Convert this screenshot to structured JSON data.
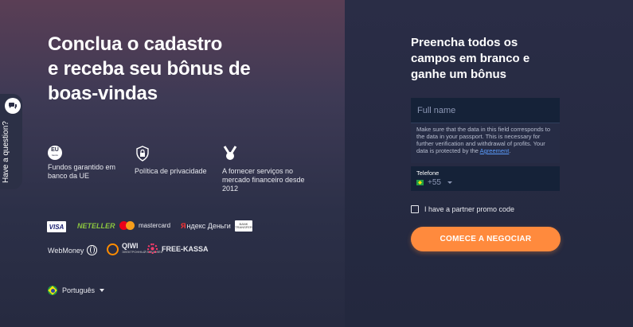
{
  "headline": [
    "Conclua o cadastro",
    "e receba seu bônus de",
    "boas-vindas"
  ],
  "question_tab": {
    "label": "Have a question?"
  },
  "features": [
    {
      "badge_top": "EU",
      "badge_bottom": "banks",
      "text": "Fundos garantido em banco da UE",
      "icon": "eu-bank-icon"
    },
    {
      "text": "Política de privacidade",
      "icon": "shield-lock-icon"
    },
    {
      "text": "A fornecer serviços no mercado financeiro desde 2012",
      "icon": "medal-icon"
    }
  ],
  "payments": {
    "visa": "VISA",
    "neteller": "NETELLER",
    "mastercard": "mastercard",
    "yandex_mark": "Я",
    "yandex": "ндекс Деньги",
    "bank_line1": "BANK",
    "bank_line2": "TRANSFER",
    "webmoney": "WebMoney",
    "qiwi": "QIWI",
    "qiwi_sub": "ЭЛЕКТРОННЫЙ КОШЕЛЁК",
    "freekassa": "FREE-KASSA"
  },
  "language": {
    "label": "Português"
  },
  "form": {
    "title": [
      "Preencha todos os",
      "campos em branco e",
      "ganhe um bônus"
    ],
    "name_placeholder": "Full name",
    "hint": "Make sure that the data in this field corresponds to the data in your passport. This is necessary for further verification and withdrawal of profits. Your data is protected by the ",
    "hint_link": "Agreement",
    "hint_end": ".",
    "phone_label": "Telefone",
    "phone_code": "+55",
    "promo_label": "I have a partner promo code",
    "cta": "COMECE A NEGOCIAR"
  },
  "colors": {
    "accent": "#ff8a3d",
    "link": "#5b9dff",
    "input_bg": "#152238"
  }
}
